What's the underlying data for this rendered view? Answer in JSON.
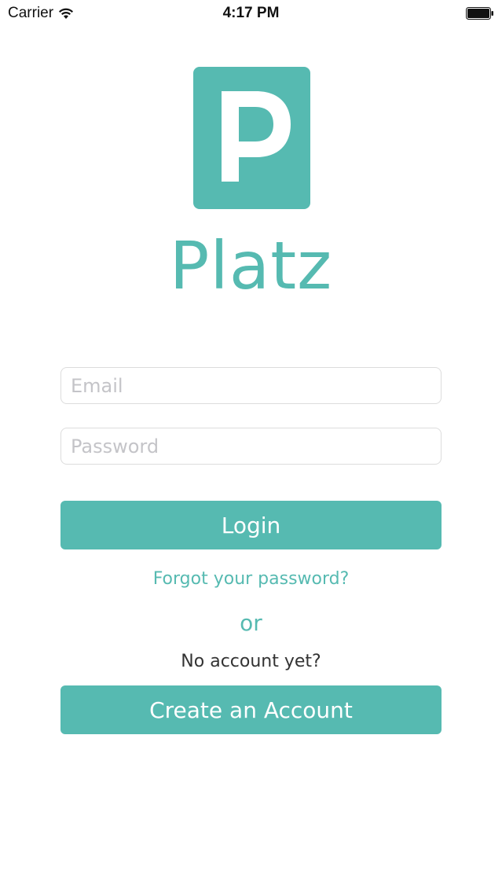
{
  "status_bar": {
    "carrier": "Carrier",
    "time": "4:17 PM",
    "wifi_icon": "wifi-icon",
    "battery_icon": "battery-icon"
  },
  "brand": {
    "logo_letter": "P",
    "name": "Platz",
    "color": "#56bab1"
  },
  "login_form": {
    "email_placeholder": "Email",
    "email_value": "",
    "password_placeholder": "Password",
    "password_value": "",
    "login_label": "Login",
    "forgot_password_label": "Forgot your password?",
    "or_label": "or",
    "no_account_label": "No account yet?",
    "create_account_label": "Create an Account"
  }
}
